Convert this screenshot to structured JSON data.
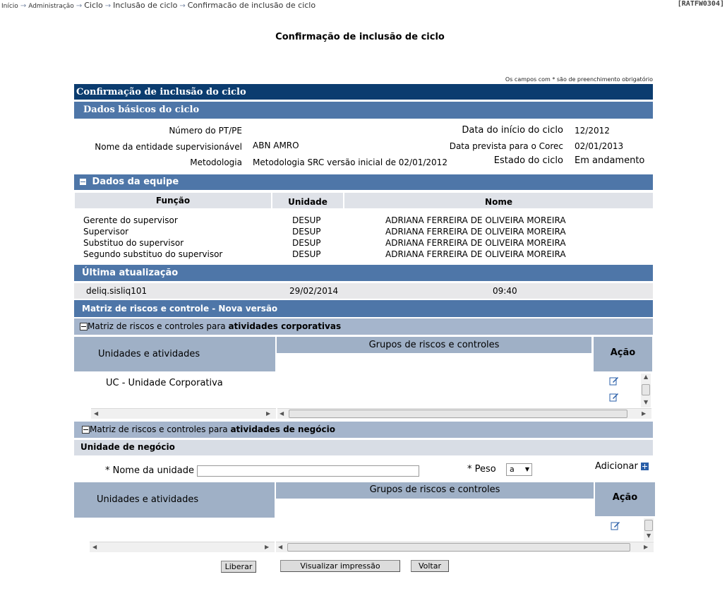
{
  "breadcrumb": {
    "items": [
      "Início",
      "Administração",
      "Ciclo",
      "Inclusão de ciclo",
      "Confirmacão de inclusão de ciclo"
    ]
  },
  "screen_id": "[RATFW0304]",
  "page_title": "Confirmação de inclusão de ciclo",
  "required_note": "Os campos com * são de preenchimento obrigatório",
  "section_confirm": "Confirmação de inclusão do ciclo",
  "basic": {
    "title": "Dados básicos do ciclo",
    "numero_label": "Número do PT/PE",
    "numero_value": "",
    "entidade_label": "Nome da entidade supervisionável",
    "entidade_value": "ABN AMRO",
    "metodologia_label": "Metodologia",
    "metodologia_value": "Metodologia SRC versão inicial de 02/01/2012",
    "inicio_label": "Data do início do ciclo",
    "inicio_value": "12/2012",
    "corec_label": "Data prevista para o Corec",
    "corec_value": "02/01/2013",
    "estado_label": "Estado do ciclo",
    "estado_value": "Em andamento"
  },
  "team": {
    "title": "Dados da equipe",
    "columns": [
      "Função",
      "Unidade",
      "Nome"
    ],
    "rows": [
      {
        "funcao": "Gerente do supervisor",
        "unidade": "DESUP",
        "nome": "ADRIANA FERREIRA  DE OLIVEIRA MOREIRA"
      },
      {
        "funcao": "Supervisor",
        "unidade": "DESUP",
        "nome": "ADRIANA FERREIRA  DE OLIVEIRA MOREIRA"
      },
      {
        "funcao": "Substituo do supervisor",
        "unidade": "DESUP",
        "nome": "ADRIANA FERREIRA  DE OLIVEIRA MOREIRA"
      },
      {
        "funcao": "Segundo substituo do supervisor",
        "unidade": "DESUP",
        "nome": "ADRIANA FERREIRA  DE OLIVEIRA MOREIRA"
      }
    ]
  },
  "update": {
    "title": "Última atualização",
    "user": "deliq.sisliq101",
    "date": "29/02/2014",
    "time": "09:40"
  },
  "matrix": {
    "title": "Matriz de riscos e controle - Nova versão",
    "corp": {
      "prefix": "Matriz de riscos e controles para ",
      "bold": "atividades corporativas",
      "col_units": "Unidades e atividades",
      "col_groups": "Grupos de riscos e controles",
      "col_action": "Ação",
      "row_label": "UC - Unidade Corporativa"
    },
    "business": {
      "prefix": "Matriz de riscos e controles para ",
      "bold": "atividades de negócio",
      "unit_title": "Unidade de negócio",
      "name_label": "* Nome da unidade",
      "name_value": "",
      "weight_label": "* Peso",
      "weight_value": "a",
      "add_label": "Adicionar",
      "col_units": "Unidades e atividades",
      "col_groups": "Grupos de riscos e controles",
      "col_action": "Ação"
    }
  },
  "buttons": {
    "liberar": "Liberar",
    "visualizar": "Visualizar impressão",
    "voltar": "Voltar"
  }
}
